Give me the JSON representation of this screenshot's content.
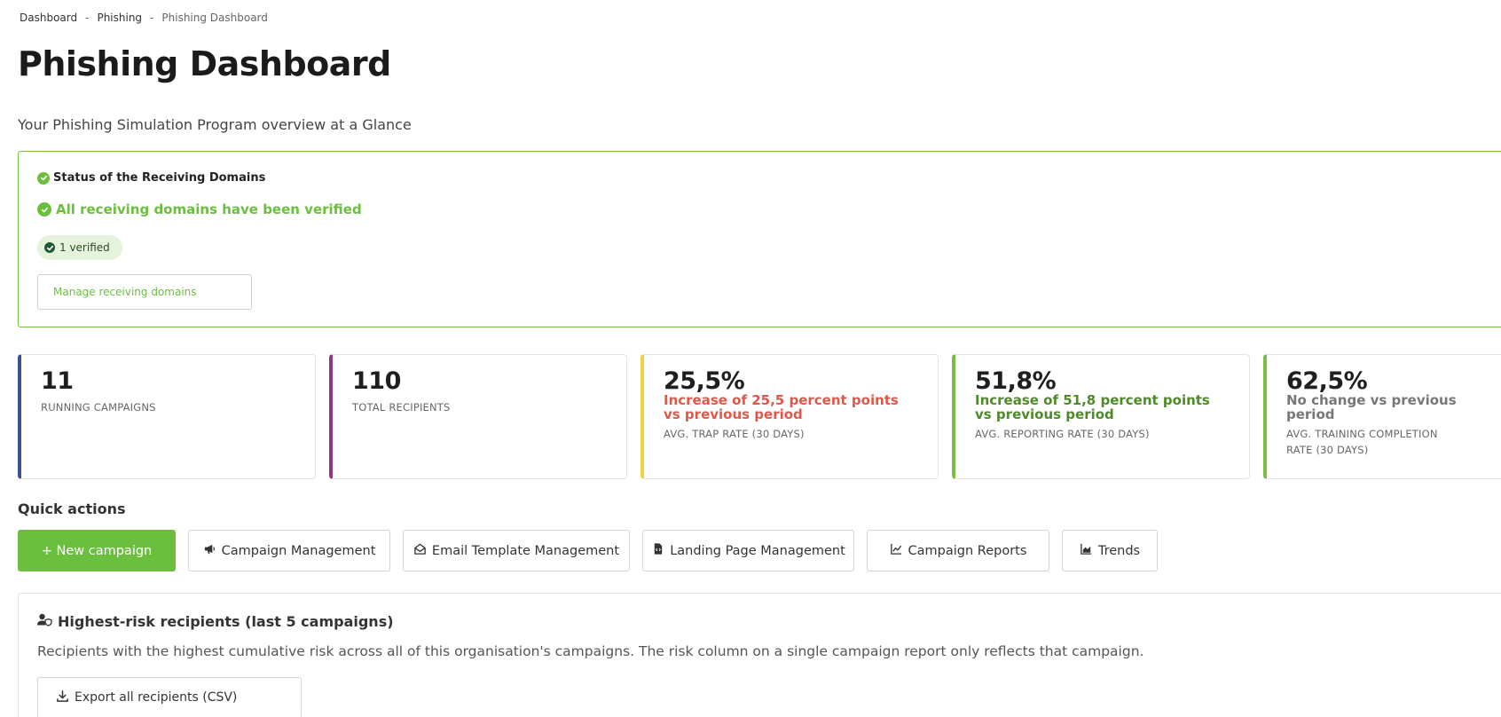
{
  "breadcrumb": {
    "items": [
      "Dashboard",
      "Phishing",
      "Phishing Dashboard"
    ],
    "separator": "-"
  },
  "page": {
    "title": "Phishing Dashboard",
    "subtitle": "Your Phishing Simulation Program overview at a Glance"
  },
  "domains": {
    "heading": "Status of the Receiving Domains",
    "status": "All receiving domains have been verified",
    "badge": "1 verified",
    "manage_label": "Manage receiving domains"
  },
  "stats": [
    {
      "value": "11",
      "change": "",
      "label": "RUNNING CAMPAIGNS",
      "accent": "#3e4f93"
    },
    {
      "value": "110",
      "change": "",
      "label": "TOTAL RECIPIENTS",
      "accent": "#8a3a84"
    },
    {
      "value": "25,5%",
      "change": "Increase of 25,5 percent points vs previous period",
      "change_color": "#e0584a",
      "label": "AVG. TRAP RATE (30 DAYS)",
      "accent": "#f2cf4a"
    },
    {
      "value": "51,8%",
      "change": "Increase of 51,8 percent points vs previous period",
      "change_color": "#4f8a2a",
      "label": "AVG. REPORTING RATE (30 DAYS)",
      "accent": "#76bf43"
    },
    {
      "value": "62,5%",
      "change": "No change vs previous period",
      "change_color": "#777777",
      "label": "AVG. TRAINING COMPLETION RATE (30 DAYS)",
      "accent": "#76bf43"
    }
  ],
  "quick_actions": {
    "title": "Quick actions",
    "new_campaign": "+ New campaign",
    "campaign_management": "Campaign Management",
    "email_template_management": "Email Template Management",
    "landing_page_management": "Landing Page Management",
    "campaign_reports": "Campaign Reports",
    "trends": "Trends"
  },
  "risk": {
    "title": "Highest-risk recipients (last 5 campaigns)",
    "description": "Recipients with the highest cumulative risk across all of this organisation's campaigns. The risk column on a single campaign report only reflects that campaign.",
    "export_label": "Export all recipients (CSV)"
  },
  "colors": {
    "brand_green": "#6cbf3e",
    "panel_border": "#76bf43"
  }
}
